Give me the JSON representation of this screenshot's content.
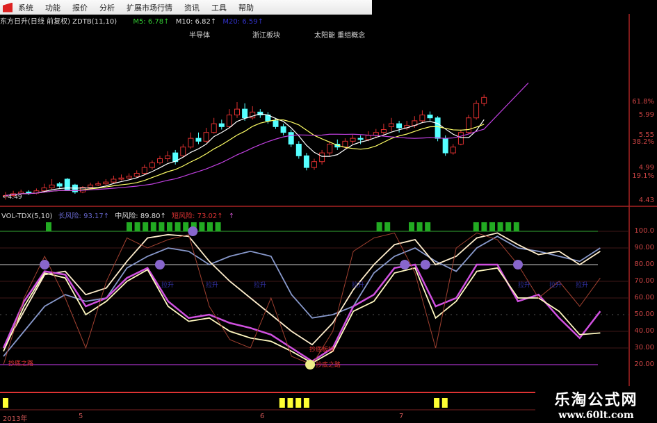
{
  "menu": [
    "系统",
    "功能",
    "报价",
    "分析",
    "扩展市场行情",
    "资讯",
    "工具",
    "帮助"
  ],
  "header": {
    "title": "东方日升(日线 前复权) ZDTB(11,10)",
    "m5": "M5: 6.78↑",
    "m10": "M10: 6.82↑",
    "m20": "M20: 6.59↑"
  },
  "tags": [
    "半导体",
    "浙江板块",
    "太阳能 重组概念"
  ],
  "price_axis": [
    "61.8%",
    "5.99",
    "5.55",
    "38.2%",
    "4.99",
    "19.1%",
    "4.43"
  ],
  "price_low_label": "←4.49",
  "indicator": {
    "name": "VOL-TDX(5,10)",
    "long": "长风险: 93.17↑",
    "mid": "中风险: 89.80↑",
    "short": "短风险: 73.02↑",
    "extra": "↑"
  },
  "ind_axis": [
    "100.0",
    "90.00",
    "80.00",
    "70.00",
    "60.00",
    "50.00",
    "40.00",
    "30.00",
    "20.00"
  ],
  "labels": {
    "left": "抄底之路",
    "bottom_a": "抄底板块",
    "bottom_b": "抄底之路",
    "blue": "拉升"
  },
  "dates": [
    "2013年",
    "5",
    "6",
    "7"
  ],
  "watermark": {
    "name": "乐淘公式网",
    "url": "www.60lt.com"
  },
  "colors": {
    "up": "#e03030",
    "down": "#5ff",
    "ma5": "#ffffff",
    "ma10": "#ffff66",
    "ma20": "#c040e0",
    "green": "#2a2",
    "yellow": "#ff3"
  },
  "chart_data": {
    "type": "candlestick",
    "price_range": [
      4.43,
      6.23
    ],
    "candles": [
      [
        4.5,
        4.52,
        4.58,
        4.45
      ],
      [
        4.52,
        4.55,
        4.6,
        4.49
      ],
      [
        4.55,
        4.58,
        4.62,
        4.52
      ],
      [
        4.58,
        4.56,
        4.61,
        4.53
      ],
      [
        4.56,
        4.6,
        4.64,
        4.54
      ],
      [
        4.6,
        4.65,
        4.72,
        4.58
      ],
      [
        4.65,
        4.7,
        4.8,
        4.63
      ],
      [
        4.72,
        4.68,
        4.75,
        4.65
      ],
      [
        4.8,
        4.62,
        4.82,
        4.6
      ],
      [
        4.7,
        4.58,
        4.72,
        4.55
      ],
      [
        4.58,
        4.66,
        4.68,
        4.56
      ],
      [
        4.66,
        4.7,
        4.74,
        4.64
      ],
      [
        4.7,
        4.72,
        4.76,
        4.68
      ],
      [
        4.72,
        4.75,
        4.8,
        4.7
      ],
      [
        4.75,
        4.8,
        4.86,
        4.73
      ],
      [
        4.8,
        4.82,
        4.88,
        4.78
      ],
      [
        4.82,
        4.85,
        4.9,
        4.8
      ],
      [
        4.85,
        4.9,
        4.95,
        4.83
      ],
      [
        4.9,
        5.0,
        5.05,
        4.88
      ],
      [
        5.0,
        5.08,
        5.12,
        4.96
      ],
      [
        5.08,
        5.15,
        5.2,
        5.05
      ],
      [
        5.15,
        5.2,
        5.28,
        5.1
      ],
      [
        5.25,
        5.1,
        5.3,
        5.05
      ],
      [
        5.2,
        5.35,
        5.4,
        5.18
      ],
      [
        5.35,
        5.5,
        5.6,
        5.32
      ],
      [
        5.5,
        5.45,
        5.6,
        5.4
      ],
      [
        5.45,
        5.6,
        5.68,
        5.42
      ],
      [
        5.6,
        5.75,
        5.85,
        5.58
      ],
      [
        5.75,
        5.7,
        5.82,
        5.65
      ],
      [
        5.7,
        5.9,
        6.0,
        5.68
      ],
      [
        5.9,
        6.0,
        6.12,
        5.85
      ],
      [
        6.0,
        5.85,
        6.1,
        5.8
      ],
      [
        5.85,
        5.95,
        6.05,
        5.82
      ],
      [
        5.95,
        5.9,
        6.0,
        5.85
      ],
      [
        5.9,
        5.8,
        5.95,
        5.75
      ],
      [
        5.8,
        5.7,
        5.85,
        5.66
      ],
      [
        5.7,
        5.6,
        5.75,
        5.55
      ],
      [
        5.6,
        5.4,
        5.65,
        5.35
      ],
      [
        5.4,
        5.2,
        5.45,
        5.15
      ],
      [
        5.2,
        5.0,
        5.25,
        4.95
      ],
      [
        5.0,
        5.1,
        5.15,
        4.96
      ],
      [
        5.1,
        5.25,
        5.3,
        5.05
      ],
      [
        5.25,
        5.4,
        5.45,
        5.2
      ],
      [
        5.4,
        5.35,
        5.48,
        5.3
      ],
      [
        5.35,
        5.45,
        5.5,
        5.32
      ],
      [
        5.45,
        5.5,
        5.56,
        5.4
      ],
      [
        5.5,
        5.48,
        5.55,
        5.4
      ],
      [
        5.48,
        5.55,
        5.62,
        5.45
      ],
      [
        5.55,
        5.6,
        5.66,
        5.5
      ],
      [
        5.6,
        5.65,
        5.75,
        5.56
      ],
      [
        5.7,
        5.75,
        5.85,
        5.62
      ],
      [
        5.75,
        5.68,
        5.8,
        5.6
      ],
      [
        5.68,
        5.72,
        5.8,
        5.64
      ],
      [
        5.72,
        5.8,
        5.88,
        5.68
      ],
      [
        5.8,
        5.9,
        5.98,
        5.76
      ],
      [
        5.9,
        5.85,
        5.96,
        5.8
      ],
      [
        5.85,
        5.5,
        5.88,
        5.45
      ],
      [
        5.5,
        5.25,
        5.55,
        5.2
      ],
      [
        5.25,
        5.35,
        5.4,
        5.22
      ],
      [
        5.4,
        5.6,
        5.65,
        5.38
      ],
      [
        5.6,
        5.85,
        5.9,
        5.58
      ],
      [
        5.85,
        6.1,
        6.15,
        5.82
      ],
      [
        6.1,
        6.2,
        6.25,
        6.05
      ]
    ],
    "indicator_range": [
      20,
      100
    ],
    "series": [
      {
        "name": "long",
        "color": "#8899cc",
        "values": [
          25,
          40,
          55,
          62,
          58,
          60,
          78,
          85,
          90,
          88,
          80,
          85,
          88,
          85,
          62,
          48,
          50,
          55,
          75,
          85,
          90,
          82,
          76,
          90,
          97,
          90,
          88,
          85,
          82,
          90
        ]
      },
      {
        "name": "mid",
        "color": "#ffeecc",
        "values": [
          30,
          52,
          74,
          76,
          62,
          66,
          82,
          96,
          98,
          97,
          82,
          70,
          60,
          50,
          40,
          32,
          45,
          65,
          80,
          92,
          95,
          80,
          85,
          96,
          99,
          92,
          86,
          88,
          80,
          88
        ]
      },
      {
        "name": "short",
        "color": "#d050e0",
        "values": [
          30,
          58,
          76,
          74,
          55,
          60,
          72,
          78,
          58,
          48,
          50,
          45,
          42,
          38,
          30,
          22,
          30,
          55,
          62,
          78,
          80,
          55,
          60,
          80,
          80,
          58,
          62,
          48,
          36,
          52
        ]
      },
      {
        "name": "signal",
        "color": "#fff8c0",
        "values": [
          28,
          55,
          75,
          72,
          50,
          58,
          70,
          77,
          55,
          46,
          48,
          40,
          36,
          34,
          28,
          21,
          28,
          52,
          58,
          75,
          78,
          48,
          58,
          76,
          78,
          60,
          60,
          52,
          38,
          39
        ]
      },
      {
        "name": "fast",
        "color": "#a04030",
        "values": [
          20,
          60,
          85,
          60,
          30,
          70,
          96,
          90,
          95,
          98,
          55,
          35,
          30,
          60,
          25,
          20,
          40,
          88,
          96,
          99,
          75,
          30,
          90,
          99,
          95,
          80,
          60,
          70,
          55,
          72
        ]
      }
    ],
    "green_bars": [
      5,
      15,
      16,
      17,
      18,
      19,
      20,
      21,
      22,
      23,
      24,
      25,
      26,
      46,
      47,
      50,
      51,
      52,
      58,
      59,
      60,
      61,
      62,
      63
    ],
    "yellow_bars": [
      0,
      34,
      35,
      36,
      37,
      53,
      54
    ],
    "signal_icons": [
      {
        "type": "frown",
        "i": 2,
        "v": 80
      },
      {
        "type": "frown",
        "i": 7.6,
        "v": 80
      },
      {
        "type": "frown",
        "i": 9.2,
        "v": 100
      },
      {
        "type": "frown",
        "i": 19.5,
        "v": 80
      },
      {
        "type": "frown",
        "i": 20.5,
        "v": 80
      },
      {
        "type": "frown",
        "i": 25,
        "v": 80
      },
      {
        "type": "smile",
        "i": 14.9,
        "v": 20
      }
    ]
  }
}
